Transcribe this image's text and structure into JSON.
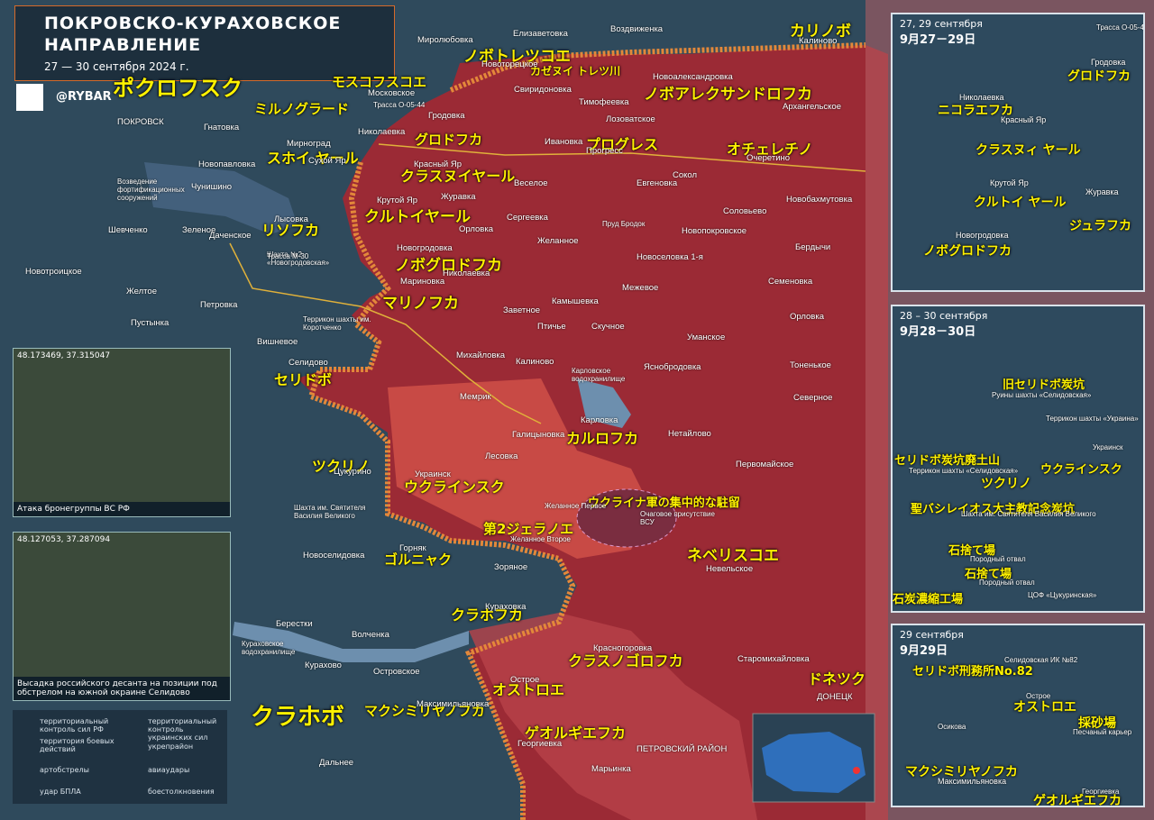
{
  "title": {
    "line1": "ПОКРОВСКО-КУРАХОВСКОЕ",
    "line2": "НАПРАВЛЕНИЕ",
    "dates": "27 — 30 сентября 2024 г.",
    "handle": "@RYBAR"
  },
  "jp_labels": [
    {
      "key": "pokrovsk",
      "text": "ポクロフスク"
    },
    {
      "key": "milnograd",
      "text": "ミルノグラード"
    },
    {
      "key": "moskovskoe",
      "text": "モスコフスコエ"
    },
    {
      "key": "novotoretskoe",
      "text": "ノボトレツコエ"
    },
    {
      "key": "kazennyi",
      "text": "カゼヌイ トレツ川"
    },
    {
      "key": "kalinovo",
      "text": "カリノボ"
    },
    {
      "key": "novoalex",
      "text": "ノボアレクサンドロフカ"
    },
    {
      "key": "grodovka",
      "text": "グロドフカ"
    },
    {
      "key": "progress",
      "text": "プログレス"
    },
    {
      "key": "ocheretino",
      "text": "オチェレチノ"
    },
    {
      "key": "sukhoi",
      "text": "スホイ ヤール"
    },
    {
      "key": "krasnyi",
      "text": "クラスヌイヤール"
    },
    {
      "key": "krutoi",
      "text": "クルトイヤール"
    },
    {
      "key": "lysovka",
      "text": "リソフカ"
    },
    {
      "key": "novogrodovka",
      "text": "ノボグロドフカ"
    },
    {
      "key": "marinovka",
      "text": "マリノフカ"
    },
    {
      "key": "selidovo",
      "text": "セリドボ"
    },
    {
      "key": "karlovka",
      "text": "カルロフカ"
    },
    {
      "key": "tsukurino",
      "text": "ツクリノ"
    },
    {
      "key": "ukrainsk",
      "text": "ウクラインスク"
    },
    {
      "key": "zhelannoe2",
      "text": "第2ジェラノエ"
    },
    {
      "key": "concentration",
      "text": "ウクライナ軍の集中的な駐留"
    },
    {
      "key": "gornyak",
      "text": "ゴルニャク"
    },
    {
      "key": "nevelskoe",
      "text": "ネベリスコエ"
    },
    {
      "key": "kurakhovka",
      "text": "クラホフカ"
    },
    {
      "key": "krasnogorovka",
      "text": "クラスノゴロフカ"
    },
    {
      "key": "donetsk",
      "text": "ドネツク"
    },
    {
      "key": "ostroe",
      "text": "オストロエ"
    },
    {
      "key": "kurakhovo",
      "text": "クラホボ"
    },
    {
      "key": "maksimilianovka",
      "text": "マクシミリヤノフカ"
    },
    {
      "key": "georgievka",
      "text": "ゲオルギエフカ"
    }
  ],
  "ru_labels": [
    {
      "key": "pokrovsk",
      "text": "ПОКРОВСК"
    },
    {
      "key": "gnatovka",
      "text": "Гнатовка"
    },
    {
      "key": "mirnograd",
      "text": "Мирноград"
    },
    {
      "key": "novopavlovka",
      "text": "Новопавловка"
    },
    {
      "key": "fortif",
      "text": "Возведение фортификационных сооружений"
    },
    {
      "key": "chunishino",
      "text": "Чунишино"
    },
    {
      "key": "shevchenko",
      "text": "Шевченко"
    },
    {
      "key": "zelenoe",
      "text": "Зеленое"
    },
    {
      "key": "dachenskoe",
      "text": "Даченское"
    },
    {
      "key": "novotroitskoe",
      "text": "Новотроицкое"
    },
    {
      "key": "zheltoe",
      "text": "Желтое"
    },
    {
      "key": "petrovka",
      "text": "Петровка"
    },
    {
      "key": "pustynka",
      "text": "Пустынка"
    },
    {
      "key": "vishnevoe",
      "text": "Вишневое"
    },
    {
      "key": "selidovo",
      "text": "Селидово"
    },
    {
      "key": "mirolyubovka",
      "text": "Миролюбовка"
    },
    {
      "key": "elizavetovka",
      "text": "Елизаветовка"
    },
    {
      "key": "vozdvizhenka",
      "text": "Воздвиженка"
    },
    {
      "key": "kalinovo",
      "text": "Калиново"
    },
    {
      "key": "novotoretskoe",
      "text": "Новоторецкое"
    },
    {
      "key": "moskovskoe",
      "text": "Московское"
    },
    {
      "key": "novoalexandrovka",
      "text": "Новоалександровка"
    },
    {
      "key": "sviridonovka",
      "text": "Свиридоновка"
    },
    {
      "key": "timofeevka",
      "text": "Тимофеевка"
    },
    {
      "key": "arkhangelskoe",
      "text": "Архангельское"
    },
    {
      "key": "nikolaevka",
      "text": "Николаевка"
    },
    {
      "key": "grodovka",
      "text": "Гродовка"
    },
    {
      "key": "ivanovka",
      "text": "Ивановка"
    },
    {
      "key": "lozovatskoe",
      "text": "Лозоватское"
    },
    {
      "key": "progress",
      "text": "Прогресс"
    },
    {
      "key": "ocheretino",
      "text": "Очеретино"
    },
    {
      "key": "sukhoi",
      "text": "Сухой Яр"
    },
    {
      "key": "krasnyi",
      "text": "Красный Яр"
    },
    {
      "key": "veseloe",
      "text": "Веселое"
    },
    {
      "key": "evgenovka",
      "text": "Евгеновка"
    },
    {
      "key": "sokol",
      "text": "Сокол"
    },
    {
      "key": "novobakhmutovka",
      "text": "Новобахмутовка"
    },
    {
      "key": "zhuravka",
      "text": "Журавка"
    },
    {
      "key": "krutoi",
      "text": "Крутой Яр"
    },
    {
      "key": "sergeevka",
      "text": "Сергеевка"
    },
    {
      "key": "soloveevo",
      "text": "Соловьево"
    },
    {
      "key": "lysovka",
      "text": "Лысовка"
    },
    {
      "key": "orlovka",
      "text": "Орловка"
    },
    {
      "key": "zhelannoe",
      "text": "Желанное"
    },
    {
      "key": "novopokrovskoe",
      "text": "Новопокровское"
    },
    {
      "key": "berdychi",
      "text": "Бердычи"
    },
    {
      "key": "shakhta2",
      "text": "Шахта №2 «Новогродовская»"
    },
    {
      "key": "novogrodovka",
      "text": "Новогродовка"
    },
    {
      "key": "novoselovka1",
      "text": "Новоселовка 1-я"
    },
    {
      "key": "semenovka",
      "text": "Семеновка"
    },
    {
      "key": "nikolaevka2",
      "text": "Николаевка"
    },
    {
      "key": "mezhevoe",
      "text": "Межевое"
    },
    {
      "key": "marinovka",
      "text": "Мариновка"
    },
    {
      "key": "kamyshevka",
      "text": "Камышевка"
    },
    {
      "key": "orlovka2",
      "text": "Орловка"
    },
    {
      "key": "zavetnoe",
      "text": "Заветное"
    },
    {
      "key": "ptichye",
      "text": "Птичье"
    },
    {
      "key": "skuchnoe",
      "text": "Скучное"
    },
    {
      "key": "umanskoe",
      "text": "Уманское"
    },
    {
      "key": "terrikon",
      "text": "Террикон шахты им. Коротченко"
    },
    {
      "key": "mikhailovka",
      "text": "Михайловка"
    },
    {
      "key": "kalinovo2",
      "text": "Калиново"
    },
    {
      "key": "yasnobrodovka",
      "text": "Яснобродовка"
    },
    {
      "key": "tonenkoe",
      "text": "Тоненькое"
    },
    {
      "key": "memrik",
      "text": "Мемрик"
    },
    {
      "key": "severnoe",
      "text": "Северное"
    },
    {
      "key": "karlovka",
      "text": "Карловка"
    },
    {
      "key": "galitsynovka",
      "text": "Галицыновка"
    },
    {
      "key": "netailovo",
      "text": "Нетайлово"
    },
    {
      "key": "lesovka",
      "text": "Лесовка"
    },
    {
      "key": "tsukurino",
      "text": "Цукурино"
    },
    {
      "key": "ukrainsk",
      "text": "Украинск"
    },
    {
      "key": "pervomaiskoe",
      "text": "Первомайское"
    },
    {
      "key": "zhelannoe1",
      "text": "Желанное Первое"
    },
    {
      "key": "vsu",
      "text": "Очаговое присутствие ВСУ"
    },
    {
      "key": "shakhta_vas",
      "text": "Шахта им. Святителя Василия Великого"
    },
    {
      "key": "zhelannoe2",
      "text": "Желанное Второе"
    },
    {
      "key": "gornyak",
      "text": "Горняк"
    },
    {
      "key": "novoselidovka",
      "text": "Новоселидовка"
    },
    {
      "key": "zoryanoe",
      "text": "Зоряное"
    },
    {
      "key": "nevelskoe",
      "text": "Невельское"
    },
    {
      "key": "kurakhovka",
      "text": "Кураховка"
    },
    {
      "key": "berestki",
      "text": "Берестки"
    },
    {
      "key": "volchenka",
      "text": "Волченка"
    },
    {
      "key": "krasnogorovka",
      "text": "Красногоровка"
    },
    {
      "key": "staromikhailovka",
      "text": "Старомихайловка"
    },
    {
      "key": "kurakhovo",
      "text": "Курахово"
    },
    {
      "key": "ostrovskoe",
      "text": "Островское"
    },
    {
      "key": "ostroe",
      "text": "Острое"
    },
    {
      "key": "maksimilianovka",
      "text": "Максимильяновка"
    },
    {
      "key": "donetsk",
      "text": "ДОНЕЦК"
    },
    {
      "key": "georgievka",
      "text": "Георгиевка"
    },
    {
      "key": "marinka",
      "text": "Марьинка"
    },
    {
      "key": "petrovskiy",
      "text": "ПЕТРОВСКИЙ РАЙОН"
    },
    {
      "key": "dalnee",
      "text": "Дальнее"
    },
    {
      "key": "trassa05",
      "text": "Трасса О-05-44"
    },
    {
      "key": "trassaM30",
      "text": "Трасса М-30"
    },
    {
      "key": "kurakh_res",
      "text": "Кураховское водохранилище"
    },
    {
      "key": "karlov_res",
      "text": "Карловское водохранилище"
    },
    {
      "key": "prud",
      "text": "Пруд Бродок"
    }
  ],
  "photos": [
    {
      "coord": "48.173469, 37.315047",
      "caption": "Атака бронегруппы ВС РФ"
    },
    {
      "coord": "48.127053, 37.287094",
      "caption": "Высадка российского десанта на позиции под обстрелом на южной окраине Селидово"
    }
  ],
  "insets": [
    {
      "hdr_ru": "27, 29 сентября",
      "hdr_jp": "9月27－29日",
      "labels": [
        {
          "key": "trassa",
          "text": "Трасса О-05-44",
          "jp": false
        },
        {
          "key": "grodovka_ru",
          "text": "Гродовка",
          "jp": false
        },
        {
          "key": "grodovka",
          "text": "グロドフカ",
          "jp": true
        },
        {
          "key": "nikolaevka_ru",
          "text": "Николаевка",
          "jp": false
        },
        {
          "key": "nikolaevka",
          "text": "ニコラエフカ",
          "jp": true
        },
        {
          "key": "krasnyi_ru",
          "text": "Красный Яр",
          "jp": false
        },
        {
          "key": "krasnyi",
          "text": "クラスヌィ ヤール",
          "jp": true
        },
        {
          "key": "krutoi_ru",
          "text": "Крутой Яр",
          "jp": false
        },
        {
          "key": "zhuravka_ru",
          "text": "Журавка",
          "jp": false
        },
        {
          "key": "krutoi",
          "text": "クルトイ ヤール",
          "jp": true
        },
        {
          "key": "zhuravka",
          "text": "ジュラフカ",
          "jp": true
        },
        {
          "key": "novogrodovka_ru",
          "text": "Новогродовка",
          "jp": false
        },
        {
          "key": "novogrodovka",
          "text": "ノボグロドフカ",
          "jp": true
        }
      ]
    },
    {
      "hdr_ru": "28 – 30 сентября",
      "hdr_jp": "9月28－30日",
      "labels": [
        {
          "key": "old_mine",
          "text": "旧セリドボ炭坑",
          "jp": true
        },
        {
          "key": "ruins",
          "text": "Руины шахты «Селидовская»",
          "jp": false
        },
        {
          "key": "terr_ukr",
          "text": "Террикон шахты «Украина»",
          "jp": false
        },
        {
          "key": "ukrainsk_ru",
          "text": "Украинск",
          "jp": false
        },
        {
          "key": "sel_dump",
          "text": "セリドボ炭坑廃土山",
          "jp": true
        },
        {
          "key": "terr_sel",
          "text": "Террикон шахты «Селидовская»",
          "jp": false
        },
        {
          "key": "tsukurino",
          "text": "ツクリノ",
          "jp": true
        },
        {
          "key": "ukrainsk",
          "text": "ウクラインスク",
          "jp": true
        },
        {
          "key": "basil",
          "text": "聖バシレイオス大主教記念炭坑",
          "jp": true
        },
        {
          "key": "shakhta",
          "text": "Шахта им. Святителя Василия Великого",
          "jp": false
        },
        {
          "key": "dump1",
          "text": "石捨て場",
          "jp": true
        },
        {
          "key": "otval1",
          "text": "Породный отвал",
          "jp": false
        },
        {
          "key": "dump2",
          "text": "石捨て場",
          "jp": true
        },
        {
          "key": "otval2",
          "text": "Породный отвал",
          "jp": false
        },
        {
          "key": "plant",
          "text": "石炭濃縮工場",
          "jp": true
        },
        {
          "key": "tsof",
          "text": "ЦОФ «Цукуринская»",
          "jp": false
        }
      ]
    },
    {
      "hdr_ru": "29 сентября",
      "hdr_jp": "9月29日",
      "labels": [
        {
          "key": "prison",
          "text": "セリドボ刑務所No.82",
          "jp": true
        },
        {
          "key": "ik82",
          "text": "Селидовская ИК №82",
          "jp": false
        },
        {
          "key": "ostroe",
          "text": "オストロエ",
          "jp": true
        },
        {
          "key": "ostroe_ru",
          "text": "Острое",
          "jp": false
        },
        {
          "key": "quarry",
          "text": "採砂場",
          "jp": true
        },
        {
          "key": "quarry_ru",
          "text": "Песчаный карьер",
          "jp": false
        },
        {
          "key": "osikova",
          "text": "Осикова",
          "jp": false
        },
        {
          "key": "maks",
          "text": "マクシミリヤノフカ",
          "jp": true
        },
        {
          "key": "maks_ru",
          "text": "Максимильяновка",
          "jp": false
        },
        {
          "key": "georg_ru",
          "text": "Георгиевка",
          "jp": false
        },
        {
          "key": "georg",
          "text": "ゲオルギエフカ",
          "jp": true
        }
      ]
    }
  ],
  "legend": [
    {
      "key": "rf",
      "text": "территориальный контроль сил РФ"
    },
    {
      "key": "ua",
      "text": "территориальный контроль украинских сил"
    },
    {
      "key": "combat",
      "text": "территория боевых действий"
    },
    {
      "key": "fort",
      "text": "укрепрайон"
    },
    {
      "key": "art",
      "text": "артобстрелы"
    },
    {
      "key": "avia",
      "text": "авиаудары"
    },
    {
      "key": "uav",
      "text": "удар БПЛА"
    },
    {
      "key": "clash",
      "text": "боестолкновения"
    }
  ],
  "colors": {
    "rf": "#9b2a35",
    "combat": "#c84a45",
    "ua": "#2f4a5c",
    "front": "#e3883a",
    "water": "#6d8fae"
  }
}
